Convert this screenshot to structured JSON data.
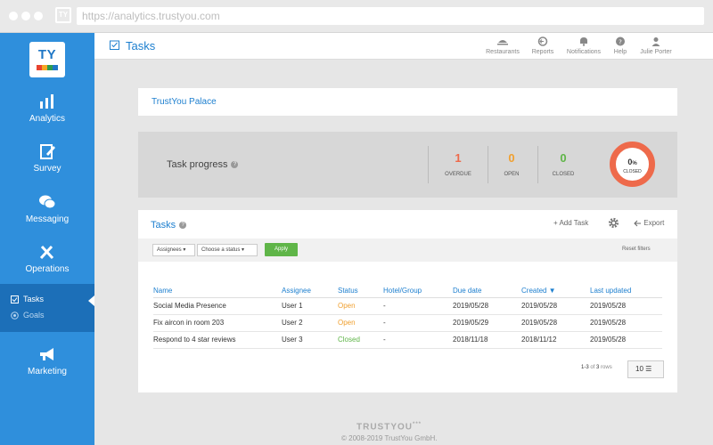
{
  "browser": {
    "favicon_text": "TY",
    "url": "https://analytics.trustyou.com"
  },
  "sidebar": {
    "logo_text": "TY",
    "items": [
      {
        "label": "Analytics",
        "icon": "bar-chart-icon"
      },
      {
        "label": "Survey",
        "icon": "clipboard-edit-icon"
      },
      {
        "label": "Messaging",
        "icon": "chat-bubbles-icon"
      },
      {
        "label": "Operations",
        "icon": "tools-icon"
      },
      {
        "label": "Marketing",
        "icon": "megaphone-icon"
      }
    ],
    "subitems": [
      {
        "label": "Tasks",
        "icon": "checkbox-icon"
      },
      {
        "label": "Goals",
        "icon": "target-icon"
      }
    ]
  },
  "header": {
    "title": "Tasks",
    "nav": [
      {
        "label": "Restaurants",
        "icon": "restaurant-icon"
      },
      {
        "label": "Reports",
        "icon": "reports-icon"
      },
      {
        "label": "Notifications",
        "icon": "bell-icon"
      },
      {
        "label": "Help",
        "icon": "help-icon"
      },
      {
        "label": "Julie Porter",
        "icon": "user-icon"
      }
    ]
  },
  "hotel_name": "TrustYou Palace",
  "progress": {
    "label": "Task progress",
    "overdue": {
      "count": "1",
      "label": "OVERDUE"
    },
    "open": {
      "count": "0",
      "label": "OPEN"
    },
    "closed": {
      "count": "0",
      "label": "CLOSED"
    },
    "ring_value": "0",
    "ring_unit": "%",
    "ring_label": "CLOSED"
  },
  "tasks": {
    "title": "Tasks",
    "add_label": "+ Add Task",
    "export_label": "Export",
    "filters": {
      "assignees": "Assignees",
      "status": "Choose a status",
      "apply": "Apply",
      "reset": "Reset filters"
    },
    "columns": [
      "Name",
      "Assignee",
      "Status",
      "Hotel/Group",
      "Due date",
      "Created ▼",
      "Last updated"
    ],
    "rows": [
      {
        "name": "Social Media Presence",
        "assignee": "User 1",
        "status": "Open",
        "hotel": "-",
        "due": "2019/05/28",
        "created": "2019/05/28",
        "updated": "2019/05/28"
      },
      {
        "name": "Fix aircon in room 203",
        "assignee": "User 2",
        "status": "Open",
        "hotel": "-",
        "due": "2019/05/29",
        "created": "2019/05/28",
        "updated": "2019/05/28"
      },
      {
        "name": "Respond to 4 star reviews",
        "assignee": "User 3",
        "status": "Closed",
        "hotel": "-",
        "due": "2018/11/18",
        "created": "2018/11/12",
        "updated": "2019/05/28"
      }
    ],
    "pager": {
      "range": "1-3",
      "of": "of",
      "total": "3",
      "rows_word": "rows",
      "page_size": "10"
    }
  },
  "footer": {
    "brand": "TRUSTYOU",
    "brand_mark": "***",
    "copyright": "© 2008-2019 TrustYou GmbH."
  },
  "colors": {
    "sidebar": "#2f8fdc",
    "accent": "#1d7fcf",
    "overdue": "#ee6a4b",
    "open": "#f0a030",
    "closed": "#5fb548"
  }
}
